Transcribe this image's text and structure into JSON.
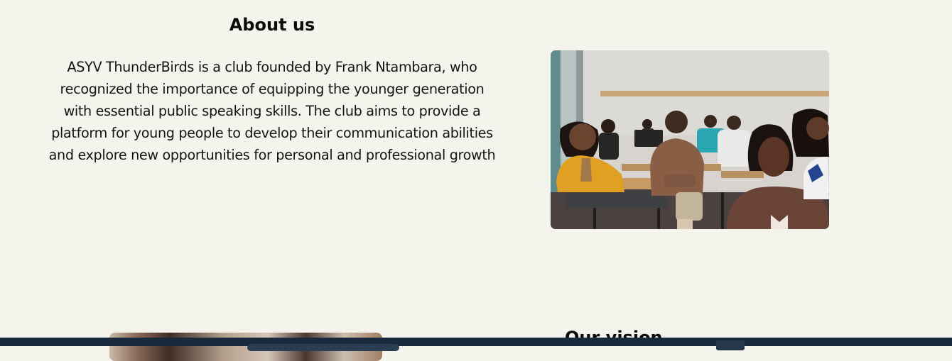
{
  "about": {
    "title": "About us",
    "text": "ASYV ThunderBirds is a club founded by Frank Ntambara, who recognized the importance of equipping the younger generation with essential public speaking skills. The club aims to provide a platform for young people to develop their communication abilities and explore new opportunities for personal and professional growth",
    "image_alt": "Students seated at desks listening attentively in a classroom"
  },
  "vision": {
    "title": "Our vision"
  },
  "colors": {
    "page_background": "#f4f3ec",
    "heading_text": "#0c0c0c",
    "body_text": "#141414",
    "bottom_bar": "#17293b"
  }
}
